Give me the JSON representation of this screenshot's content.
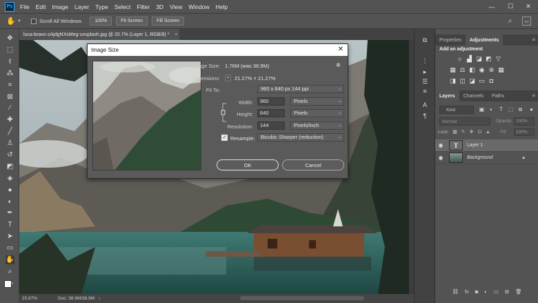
{
  "app": {
    "logo": "Ps",
    "menu": [
      "File",
      "Edit",
      "Image",
      "Layer",
      "Type",
      "Select",
      "Filter",
      "3D",
      "View",
      "Window",
      "Help"
    ],
    "window_controls": [
      "—",
      "☐",
      "✕"
    ]
  },
  "options_bar": {
    "scroll_all_windows": "Scroll All Windows",
    "zoom_100": "100%",
    "fit_screen": "Fit Screen",
    "fill_screen": "Fill Screen"
  },
  "document": {
    "tab_title": "luca-bravo-zAjdgNXsMeg-unsplash.jpg @ 20.7% (Layer 1, RGB/8) *",
    "tab_close": "×"
  },
  "status_bar": {
    "zoom": "20.67%",
    "doc": "Doc: 38.9M/38.9M",
    "arrow": "›"
  },
  "image_size_dialog": {
    "title": "Image Size",
    "close": "✕",
    "image_size_label": "Image Size:",
    "image_size_value": "1.76M (was 38.9M)",
    "dimensions_label": "Dimensions:",
    "dimensions_value": "21.27%  ×  21.27%",
    "dimensions_caret": "⌄",
    "fit_to_label": "Fit To:",
    "fit_to_value": "960 x 640 px 144 ppi",
    "width_label": "Width:",
    "width_value": "960",
    "width_unit": "Pixels",
    "height_label": "Height:",
    "height_value": "640",
    "height_unit": "Pixels",
    "resolution_label": "Resolution:",
    "resolution_value": "144",
    "resolution_unit": "Pixels/Inch",
    "resample_label": "Resample:",
    "resample_value": "Bicubic Sharper (reduction)",
    "ok": "OK",
    "cancel": "Cancel",
    "gear": "✲"
  },
  "panels": {
    "top_tabs": [
      "Properties",
      "Adjustments"
    ],
    "active_top_tab": "Adjustments",
    "add_adjustment": "Add an adjustment",
    "layer_tabs": [
      "Layers",
      "Channels",
      "Paths"
    ],
    "kind": "Kind",
    "blend_mode": "Normal",
    "opacity_label": "Opacity:",
    "opacity_value": "100%",
    "lock_label": "Lock:",
    "fill_label": "Fill:",
    "fill_value": "100%",
    "layers": [
      {
        "name": "Layer 1",
        "selected": true,
        "thumb": "T"
      },
      {
        "name": "Background",
        "selected": false
      }
    ]
  },
  "colors": {
    "ui_bg": "#535353",
    "panel_dark": "#424242",
    "accent_blue": "#31a8ff"
  }
}
